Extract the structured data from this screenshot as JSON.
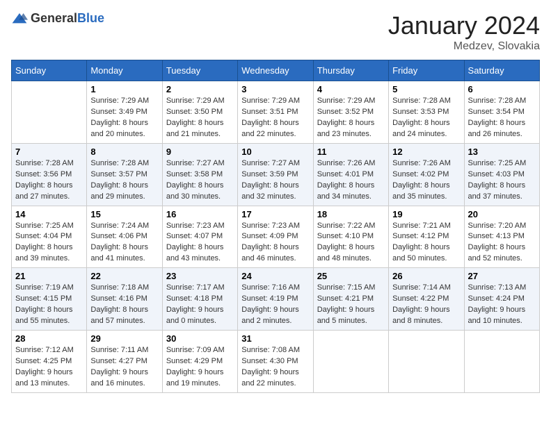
{
  "header": {
    "logo_general": "General",
    "logo_blue": "Blue",
    "title": "January 2024",
    "subtitle": "Medzev, Slovakia"
  },
  "weekdays": [
    "Sunday",
    "Monday",
    "Tuesday",
    "Wednesday",
    "Thursday",
    "Friday",
    "Saturday"
  ],
  "weeks": [
    [
      {
        "day": "",
        "detail": ""
      },
      {
        "day": "1",
        "detail": "Sunrise: 7:29 AM\nSunset: 3:49 PM\nDaylight: 8 hours\nand 20 minutes."
      },
      {
        "day": "2",
        "detail": "Sunrise: 7:29 AM\nSunset: 3:50 PM\nDaylight: 8 hours\nand 21 minutes."
      },
      {
        "day": "3",
        "detail": "Sunrise: 7:29 AM\nSunset: 3:51 PM\nDaylight: 8 hours\nand 22 minutes."
      },
      {
        "day": "4",
        "detail": "Sunrise: 7:29 AM\nSunset: 3:52 PM\nDaylight: 8 hours\nand 23 minutes."
      },
      {
        "day": "5",
        "detail": "Sunrise: 7:28 AM\nSunset: 3:53 PM\nDaylight: 8 hours\nand 24 minutes."
      },
      {
        "day": "6",
        "detail": "Sunrise: 7:28 AM\nSunset: 3:54 PM\nDaylight: 8 hours\nand 26 minutes."
      }
    ],
    [
      {
        "day": "7",
        "detail": "Sunrise: 7:28 AM\nSunset: 3:56 PM\nDaylight: 8 hours\nand 27 minutes."
      },
      {
        "day": "8",
        "detail": "Sunrise: 7:28 AM\nSunset: 3:57 PM\nDaylight: 8 hours\nand 29 minutes."
      },
      {
        "day": "9",
        "detail": "Sunrise: 7:27 AM\nSunset: 3:58 PM\nDaylight: 8 hours\nand 30 minutes."
      },
      {
        "day": "10",
        "detail": "Sunrise: 7:27 AM\nSunset: 3:59 PM\nDaylight: 8 hours\nand 32 minutes."
      },
      {
        "day": "11",
        "detail": "Sunrise: 7:26 AM\nSunset: 4:01 PM\nDaylight: 8 hours\nand 34 minutes."
      },
      {
        "day": "12",
        "detail": "Sunrise: 7:26 AM\nSunset: 4:02 PM\nDaylight: 8 hours\nand 35 minutes."
      },
      {
        "day": "13",
        "detail": "Sunrise: 7:25 AM\nSunset: 4:03 PM\nDaylight: 8 hours\nand 37 minutes."
      }
    ],
    [
      {
        "day": "14",
        "detail": "Sunrise: 7:25 AM\nSunset: 4:04 PM\nDaylight: 8 hours\nand 39 minutes."
      },
      {
        "day": "15",
        "detail": "Sunrise: 7:24 AM\nSunset: 4:06 PM\nDaylight: 8 hours\nand 41 minutes."
      },
      {
        "day": "16",
        "detail": "Sunrise: 7:23 AM\nSunset: 4:07 PM\nDaylight: 8 hours\nand 43 minutes."
      },
      {
        "day": "17",
        "detail": "Sunrise: 7:23 AM\nSunset: 4:09 PM\nDaylight: 8 hours\nand 46 minutes."
      },
      {
        "day": "18",
        "detail": "Sunrise: 7:22 AM\nSunset: 4:10 PM\nDaylight: 8 hours\nand 48 minutes."
      },
      {
        "day": "19",
        "detail": "Sunrise: 7:21 AM\nSunset: 4:12 PM\nDaylight: 8 hours\nand 50 minutes."
      },
      {
        "day": "20",
        "detail": "Sunrise: 7:20 AM\nSunset: 4:13 PM\nDaylight: 8 hours\nand 52 minutes."
      }
    ],
    [
      {
        "day": "21",
        "detail": "Sunrise: 7:19 AM\nSunset: 4:15 PM\nDaylight: 8 hours\nand 55 minutes."
      },
      {
        "day": "22",
        "detail": "Sunrise: 7:18 AM\nSunset: 4:16 PM\nDaylight: 8 hours\nand 57 minutes."
      },
      {
        "day": "23",
        "detail": "Sunrise: 7:17 AM\nSunset: 4:18 PM\nDaylight: 9 hours\nand 0 minutes."
      },
      {
        "day": "24",
        "detail": "Sunrise: 7:16 AM\nSunset: 4:19 PM\nDaylight: 9 hours\nand 2 minutes."
      },
      {
        "day": "25",
        "detail": "Sunrise: 7:15 AM\nSunset: 4:21 PM\nDaylight: 9 hours\nand 5 minutes."
      },
      {
        "day": "26",
        "detail": "Sunrise: 7:14 AM\nSunset: 4:22 PM\nDaylight: 9 hours\nand 8 minutes."
      },
      {
        "day": "27",
        "detail": "Sunrise: 7:13 AM\nSunset: 4:24 PM\nDaylight: 9 hours\nand 10 minutes."
      }
    ],
    [
      {
        "day": "28",
        "detail": "Sunrise: 7:12 AM\nSunset: 4:25 PM\nDaylight: 9 hours\nand 13 minutes."
      },
      {
        "day": "29",
        "detail": "Sunrise: 7:11 AM\nSunset: 4:27 PM\nDaylight: 9 hours\nand 16 minutes."
      },
      {
        "day": "30",
        "detail": "Sunrise: 7:09 AM\nSunset: 4:29 PM\nDaylight: 9 hours\nand 19 minutes."
      },
      {
        "day": "31",
        "detail": "Sunrise: 7:08 AM\nSunset: 4:30 PM\nDaylight: 9 hours\nand 22 minutes."
      },
      {
        "day": "",
        "detail": ""
      },
      {
        "day": "",
        "detail": ""
      },
      {
        "day": "",
        "detail": ""
      }
    ]
  ]
}
